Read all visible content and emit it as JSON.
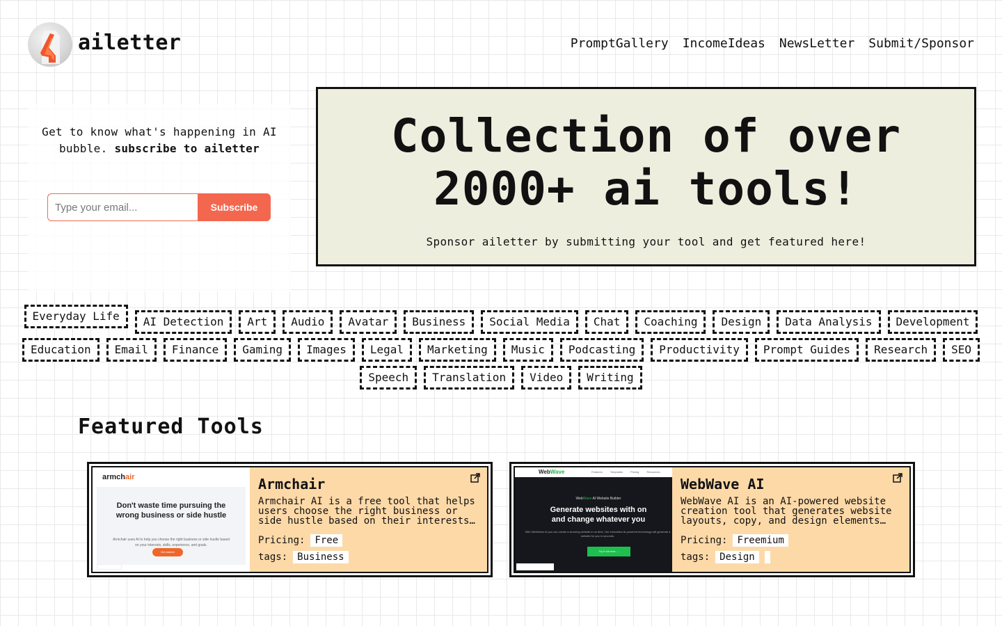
{
  "header": {
    "brand": "ailetter",
    "nav": [
      "PromptGallery",
      "IncomeIdeas",
      "NewsLetter",
      "Submit/Sponsor"
    ]
  },
  "subscribe": {
    "text": "Get to know what's happening in AI bubble.",
    "cta_text": "subscribe to ailetter",
    "placeholder": "Type your email...",
    "button": "Subscribe"
  },
  "hero": {
    "title": "Collection of over 2000+ ai tools!",
    "subtitle": "Sponsor ailetter by submitting your tool and get featured here!"
  },
  "categories": [
    "Everyday Life",
    "AI Detection",
    "Art",
    "Audio",
    "Avatar",
    "Business",
    "Social Media",
    "Chat",
    "Coaching",
    "Design",
    "Data Analysis",
    "Development",
    "Education",
    "Email",
    "Finance",
    "Gaming",
    "Images",
    "Legal",
    "Marketing",
    "Music",
    "Podcasting",
    "Productivity",
    "Prompt Guides",
    "Research",
    "SEO",
    "Speech",
    "Translation",
    "Video",
    "Writing"
  ],
  "featured": {
    "title": "Featured Tools",
    "pricing_label": "Pricing:",
    "tags_label": "tags:",
    "tools": [
      {
        "name": "Armchair",
        "description": "Armchair AI is a free tool that helps users choose the right business or side hustle based on their interests, skills, experience, and goals.",
        "pricing": "Free",
        "tags": [
          "Business"
        ],
        "thumb": {
          "logo_a": "armch",
          "logo_b": "air",
          "headline": "Don't waste time pursuing the wrong business or side hustle",
          "sub": "Armchair uses AI to help you choose the right business or side hustle based on your interests, skills, experience, and goals.",
          "cta": "Get started"
        }
      },
      {
        "name": "WebWave AI",
        "description": "WebWave AI is an AI-powered website creation tool that generates website layouts, copy, and design elements based on your needs.",
        "pricing": "Freemium",
        "tags": [
          "Design"
        ],
        "thumb": {
          "logo_a": "Web",
          "logo_b": "Wave",
          "nav": "Features Templates Pricing Resources",
          "small_a": "Web",
          "small_b": "Wave",
          "small_c": "AI Website Builder",
          "headline_1": "Generate websites with on",
          "headline_2": "and change whatever you",
          "sub": "With WebWave AI you can create a stunning website in no time. Our innovative AI-powered technology will generate a website for you in seconds.",
          "cta": "Try it out now →"
        }
      }
    ]
  },
  "colors": {
    "accent": "#f4674f",
    "hero_bg": "#eeeedf",
    "card_bg": "#fdd9a8"
  },
  "icons": {
    "external": "external-link-icon",
    "logo": "ailetter-logo-icon"
  }
}
